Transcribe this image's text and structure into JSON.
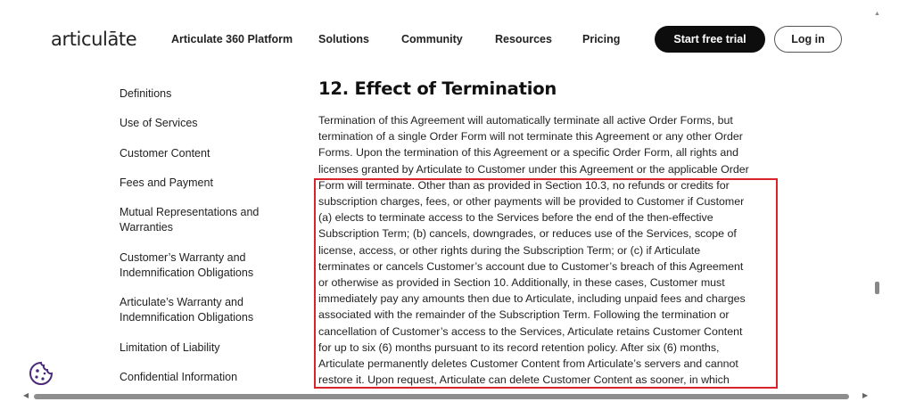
{
  "header": {
    "logo": "articulāte",
    "nav": [
      "Articulate 360 Platform",
      "Solutions",
      "Community",
      "Resources",
      "Pricing"
    ],
    "cta_label": "Start free trial",
    "login_label": "Log in"
  },
  "sidebar": {
    "items": [
      {
        "label": "Definitions"
      },
      {
        "label": "Use of Services"
      },
      {
        "label": "Customer Content"
      },
      {
        "label": "Fees and Payment"
      },
      {
        "label": "Mutual Representations and Warranties"
      },
      {
        "label": "Customer’s Warranty and Indemnification Obligations"
      },
      {
        "label": "Articulate’s Warranty and Indemnification Obligations"
      },
      {
        "label": "Limitation of Liability"
      },
      {
        "label": "Confidential Information"
      }
    ]
  },
  "main": {
    "title": "12. Effect of Termination",
    "lines": [
      "Termination of this Agreement will automatically terminate all active Order Forms, but",
      "termination of a single Order Form will not terminate this Agreement or any other Order",
      "Forms. Upon the termination of this Agreement or a specific Order Form, all rights and",
      "licenses granted by Articulate to Customer under this Agreement or the applicable Order",
      "Form will terminate. Other than as provided in Section 10.3, no refunds or credits for",
      "subscription charges, fees, or other payments will be provided to Customer if Customer",
      "(a) elects to terminate access to the Services before the end of the then-effective",
      "Subscription Term; (b) cancels, downgrades, or reduces use of the Services, scope of",
      "license, access, or other rights during the Subscription Term; or (c) if Articulate",
      "terminates or cancels Customer’s account due to Customer’s breach of this Agreement",
      "or otherwise as provided in Section 10.  Additionally, in these cases, Customer must",
      "immediately pay any amounts then due to Articulate, including unpaid fees and charges",
      "associated with the remainder of the Subscription Term. Following the termination or",
      "cancellation of Customer’s access to the Services, Articulate retains Customer Content",
      "for up to six (6) months pursuant to its record retention policy. After six (6) months,",
      "Articulate permanently deletes Customer Content from Articulate’s servers and cannot",
      "restore it. Upon request, Articulate can delete Customer Content as sooner, in which"
    ]
  },
  "colors": {
    "highlight": "#d9242c",
    "cookie_icon": "#4b2a7b"
  }
}
